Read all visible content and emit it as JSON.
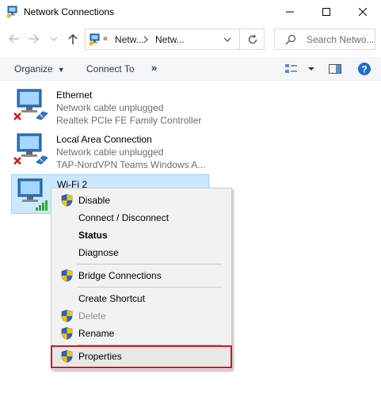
{
  "window": {
    "title": "Network Connections",
    "title_icon": "network-connections-icon"
  },
  "address": {
    "chevrons": "«",
    "crumbs": [
      "Netw...",
      "Netw..."
    ],
    "search_placeholder": "Search Netwo..."
  },
  "toolbar": {
    "organize": "Organize",
    "connect_to": "Connect To",
    "more": "»"
  },
  "connections": [
    {
      "name": "Ethernet",
      "status": "Network cable unplugged",
      "device": "Realtek PCIe FE Family Controller",
      "state": "disconnected"
    },
    {
      "name": "Local Area Connection",
      "status": "Network cable unplugged",
      "device": "TAP-NordVPN Teams Windows A...",
      "state": "disconnected"
    },
    {
      "name": "Wi-Fi 2",
      "status": "",
      "device": "",
      "state": "selected"
    }
  ],
  "context_menu": {
    "items": [
      {
        "label": "Disable",
        "shield": true,
        "style": "normal"
      },
      {
        "label": "Connect / Disconnect",
        "shield": false,
        "style": "normal"
      },
      {
        "label": "Status",
        "shield": false,
        "style": "bold"
      },
      {
        "label": "Diagnose",
        "shield": false,
        "style": "normal"
      },
      {
        "label": "Bridge Connections",
        "shield": true,
        "style": "normal"
      },
      {
        "label": "Create Shortcut",
        "shield": false,
        "style": "normal"
      },
      {
        "label": "Delete",
        "shield": true,
        "style": "disabled"
      },
      {
        "label": "Rename",
        "shield": true,
        "style": "normal"
      },
      {
        "label": "Properties",
        "shield": true,
        "style": "highlighted"
      }
    ]
  },
  "colors": {
    "accent": "#0078d7",
    "selection_bg": "#cce8ff",
    "highlight_border": "#d9141e",
    "menu_bg": "#f2f2f2"
  }
}
